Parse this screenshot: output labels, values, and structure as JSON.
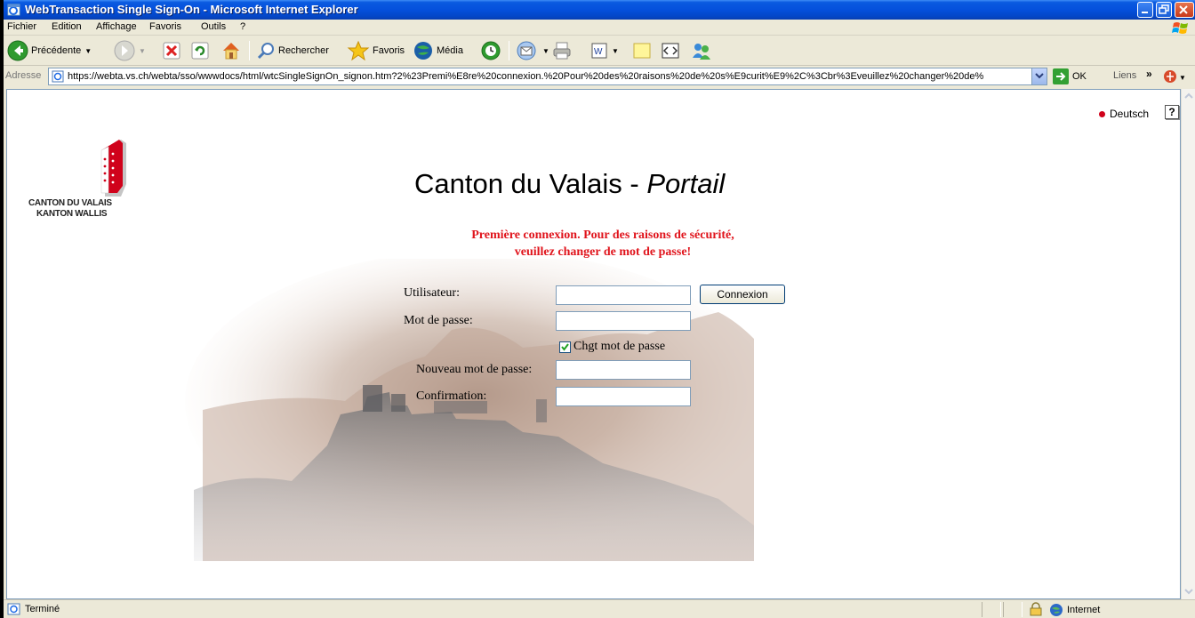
{
  "window": {
    "title": "WebTransaction Single Sign-On - Microsoft Internet Explorer"
  },
  "menu": {
    "items": [
      "Fichier",
      "Edition",
      "Affichage",
      "Favoris",
      "Outils",
      "?"
    ]
  },
  "toolbar": {
    "back_label": "Précédente",
    "search_label": "Rechercher",
    "favorites_label": "Favoris",
    "media_label": "Média"
  },
  "address": {
    "label": "Adresse",
    "url": "https://webta.vs.ch/webta/sso/wwwdocs/html/wtcSingleSignOn_signon.htm?2%23Premi%E8re%20connexion.%20Pour%20des%20raisons%20de%20s%E9curit%E9%2C%3Cbr%3Eveuillez%20changer%20de%",
    "go_label": "OK",
    "links_label": "Liens"
  },
  "page": {
    "logo_line1": "CANTON DU VALAIS",
    "logo_line2": "KANTON WALLIS",
    "language_link": "Deutsch",
    "help_glyph": "?",
    "title_main": "Canton du Valais - ",
    "title_italic": "Portail",
    "warning_line1": "Première connexion. Pour des raisons de sécurité,",
    "warning_line2": "veuillez changer de mot de passe!",
    "form": {
      "user_label": "Utilisateur:",
      "user_value": "",
      "password_label": "Mot de passe:",
      "password_value": "",
      "connect_button": "Connexion",
      "change_pw_checkbox_label": "Chgt mot de passe",
      "change_pw_checked": true,
      "new_password_label": "Nouveau mot de passe:",
      "new_password_value": "",
      "confirm_label": "Confirmation:",
      "confirm_value": ""
    }
  },
  "status": {
    "text": "Terminé",
    "zone": "Internet"
  },
  "colors": {
    "title_bar": "#0550dc",
    "warning_text": "#e0141c",
    "valais_red": "#d0021b"
  }
}
